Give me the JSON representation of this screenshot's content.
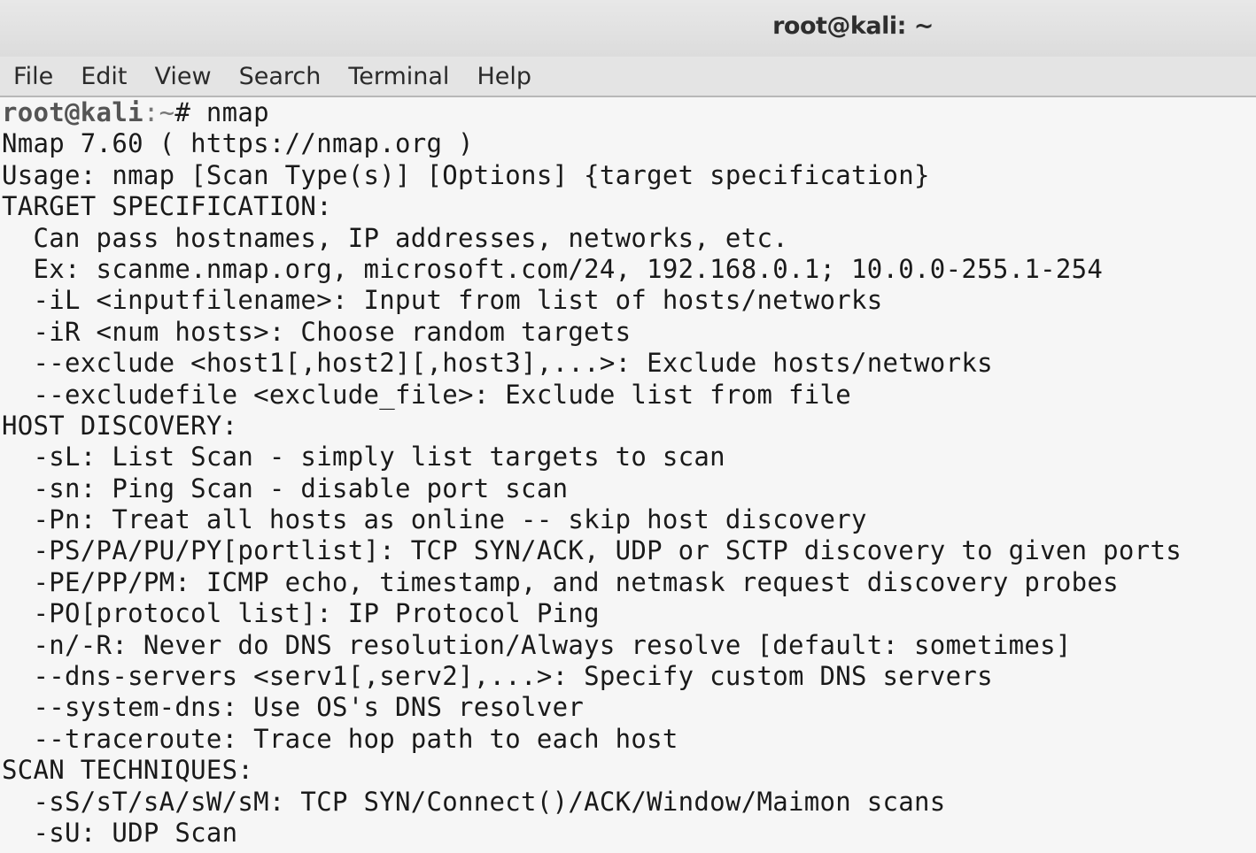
{
  "window": {
    "title": "root@kali: ~"
  },
  "menu": {
    "items": [
      "File",
      "Edit",
      "View",
      "Search",
      "Terminal",
      "Help"
    ]
  },
  "terminal": {
    "prompt_user": "root@kali",
    "prompt_path": ":~",
    "prompt_symbol": "# ",
    "command": "nmap",
    "output": [
      "Nmap 7.60 ( https://nmap.org )",
      "Usage: nmap [Scan Type(s)] [Options] {target specification}",
      "TARGET SPECIFICATION:",
      "  Can pass hostnames, IP addresses, networks, etc.",
      "  Ex: scanme.nmap.org, microsoft.com/24, 192.168.0.1; 10.0.0-255.1-254",
      "  -iL <inputfilename>: Input from list of hosts/networks",
      "  -iR <num hosts>: Choose random targets",
      "  --exclude <host1[,host2][,host3],...>: Exclude hosts/networks",
      "  --excludefile <exclude_file>: Exclude list from file",
      "HOST DISCOVERY:",
      "  -sL: List Scan - simply list targets to scan",
      "  -sn: Ping Scan - disable port scan",
      "  -Pn: Treat all hosts as online -- skip host discovery",
      "  -PS/PA/PU/PY[portlist]: TCP SYN/ACK, UDP or SCTP discovery to given ports",
      "  -PE/PP/PM: ICMP echo, timestamp, and netmask request discovery probes",
      "  -PO[protocol list]: IP Protocol Ping",
      "  -n/-R: Never do DNS resolution/Always resolve [default: sometimes]",
      "  --dns-servers <serv1[,serv2],...>: Specify custom DNS servers",
      "  --system-dns: Use OS's DNS resolver",
      "  --traceroute: Trace hop path to each host",
      "SCAN TECHNIQUES:",
      "  -sS/sT/sA/sW/sM: TCP SYN/Connect()/ACK/Window/Maimon scans",
      "  -sU: UDP Scan"
    ]
  }
}
